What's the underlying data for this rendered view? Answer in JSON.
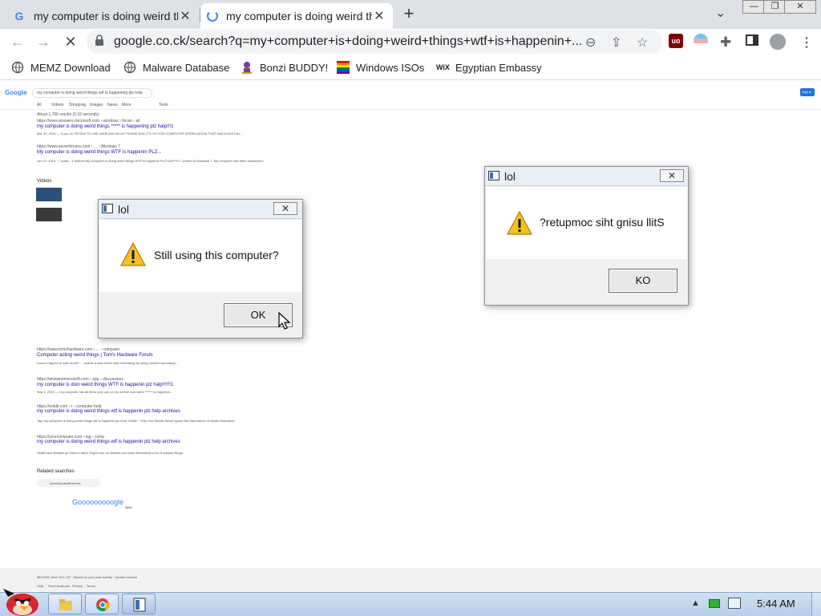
{
  "browser": {
    "tabs": [
      {
        "title": "my computer is doing weird things wtf is happening"
      },
      {
        "title": "my computer is doing weird things wtf is happening"
      }
    ],
    "new_tab_symbol": "+",
    "tab_close_symbol": "✕",
    "url": "google.co.ck/search?q=my+computer+is+doing+weird+things+wtf+is+happenin+...",
    "window_controls": [
      "—",
      "❐",
      "✕"
    ]
  },
  "bookmarks": [
    {
      "label": "MEMZ Download",
      "icon": "globe-icon"
    },
    {
      "label": "Malware Database",
      "icon": "globe-icon"
    },
    {
      "label": "Bonzi BUDDY!",
      "icon": "bonzi-icon"
    },
    {
      "label": "Windows ISOs",
      "icon": "rainbow-flag-icon"
    },
    {
      "label": "Egyptian Embassy",
      "icon": "wix-icon"
    }
  ],
  "google": {
    "logo": "Google",
    "sign_in": "Sign in",
    "query": "my computer is doing weird things wtf is happening pls help",
    "result_stats": "About 1,700 results (0.32 seconds)",
    "tabs": [
      "All",
      "Videos",
      "Shopping",
      "Images",
      "News",
      "More",
      "Tools"
    ],
    "results": [
      {
        "url": "https://www.answers.microsoft.com › windows › forum › all",
        "title": "my computer is doing weird things ***** is happening plz halp!!!1",
        "snippet": "Mar 30, 2016 — If you 're TRYING TO USE WEBCAM ON MY PHONE AND IT'S SO FOR COMPUTER VERIFICATION THAT HAS A DIGITIAL..."
      },
      {
        "url": "https://www.sevenforums.com › ... › Windows 7",
        "title": "My computer is doing weird things WTF is happenin PLZ...",
        "snippet": "Jun 12, 2013 · 7 posts · 3 authors  My computer is doing weird things WTF is happenin PLZ HALP!!!1 I posted in Windows 7. My computer has been possessed."
      },
      {
        "url": "https://www.tomshardware.com › ... › computer",
        "title": "Computer acting weird things | Tom's Hardware Forum",
        "snippet": "Does it happen in safe mode? ... enable a safe mode with networking by using number secondary..."
      },
      {
        "url": "https://answersmicrosoft.com › app › discussions",
        "title": "my computer is doin weird things WTF is happenin plz halp!!!!!!1",
        "snippet": "May 1, 2013 — my computer has all these pop ups on my screen and weird ****** is happenin..."
      },
      {
        "url": "https://reddit.com › r › computer help",
        "title": "my computer is doing weird things wtf is happenin plz help archives",
        "snippet": "Tag: my computer is doing weird things wtf is happenin plz help. Health · Why You Should Never Ignore the Importance of Health Insurance."
      },
      {
        "url": "https://yourcomputer.com › tag › comp",
        "title": "my computer is doing weird things wtf is happenin plz help archives",
        "snippet": "Health and lifestyle go hand in hand. Right now, no lifestyle you have determines a lot of outside things..."
      }
    ],
    "videos_label": "Videos",
    "related_label": "Related searches",
    "related": [
      "doesthiscalloftheends"
    ],
    "pager": "Gooooooooogle",
    "next": "Next",
    "footer": "9810006, New York, NY · Based on your past activity · Update location",
    "footer_links": [
      "Help",
      "Send feedback",
      "Privacy",
      "Terms"
    ]
  },
  "dialogs": [
    {
      "title": "lol",
      "message": "Still using this computer?",
      "button": "OK",
      "close": "✕"
    },
    {
      "title": "lol",
      "message": "?retupmoc siht gnisu llitS",
      "button": "KO",
      "close": "✕"
    }
  ],
  "taskbar": {
    "clock": "5:44 AM",
    "tray_arrow": "▲"
  },
  "colors": {
    "tabstrip": "#dee1e6",
    "link": "#1a0dab",
    "taskbar": "#b7cde8",
    "warning": "#f6c21c"
  }
}
